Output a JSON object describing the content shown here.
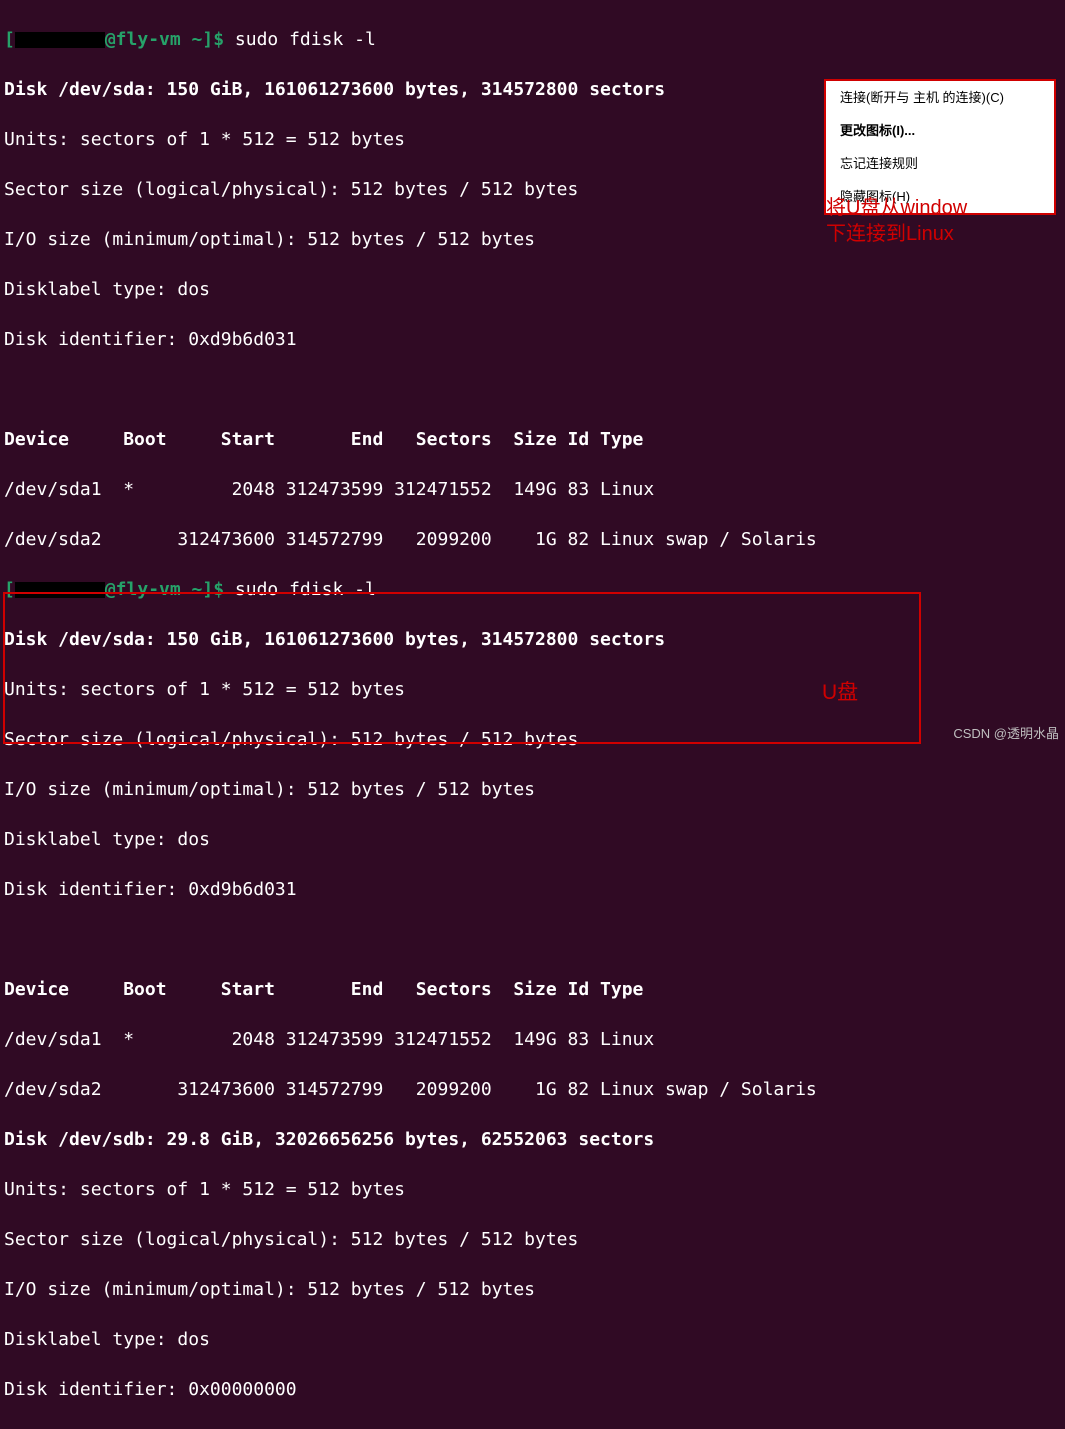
{
  "prompt1": {
    "user": "@fly-vm",
    "path": " ~",
    "cmd": "sudo fdisk -l"
  },
  "out1": {
    "diskline": "Disk /dev/sda: 150 GiB, 161061273600 bytes, 314572800 sectors",
    "units": "Units: sectors of 1 * 512 = 512 bytes",
    "sector": "Sector size (logical/physical): 512 bytes / 512 bytes",
    "io": "I/O size (minimum/optimal): 512 bytes / 512 bytes",
    "label": "Disklabel type: dos",
    "ident": "Disk identifier: 0xd9b6d031"
  },
  "table1": {
    "header": "Device     Boot     Start       End   Sectors  Size Id Type",
    "row1": "/dev/sda1  *         2048 312473599 312471552  149G 83 Linux",
    "row2": "/dev/sda2       312473600 314572799   2099200    1G 82 Linux swap / Solaris"
  },
  "prompt2": {
    "user": "@fly-vm",
    "path": " ~",
    "cmd": "sudo fdisk -l"
  },
  "out2": {
    "diskline": "Disk /dev/sda: 150 GiB, 161061273600 bytes, 314572800 sectors",
    "units": "Units: sectors of 1 * 512 = 512 bytes",
    "sector": "Sector size (logical/physical): 512 bytes / 512 bytes",
    "io": "I/O size (minimum/optimal): 512 bytes / 512 bytes",
    "label": "Disklabel type: dos",
    "ident": "Disk identifier: 0xd9b6d031"
  },
  "table2": {
    "header": "Device     Boot     Start       End   Sectors  Size Id Type",
    "row1": "/dev/sda1  *         2048 312473599 312471552  149G 83 Linux",
    "row2": "/dev/sda2       312473600 314572799   2099200    1G 82 Linux swap / Solaris"
  },
  "out3": {
    "diskline": "Disk /dev/sdb: 29.8 GiB, 32026656256 bytes, 62552063 sectors",
    "units": "Units: sectors of 1 * 512 = 512 bytes",
    "sector": "Sector size (logical/physical): 512 bytes / 512 bytes",
    "io": "I/O size (minimum/optimal): 512 bytes / 512 bytes",
    "label": "Disklabel type: dos",
    "ident": "Disk identifier: 0x00000000"
  },
  "menu": {
    "item1": "连接(断开与 主机 的连接)(C)",
    "item2": "更改图标(I)...",
    "item3": "忘记连接规则",
    "item4": "隐藏图标(H)"
  },
  "annotation1_line1": "将U盘从window",
  "annotation1_line2": "下连接到Linux",
  "annotation2": "U盘",
  "watermark": "CSDN @透明水晶",
  "brackets": {
    "open": "[",
    "close": "]$ "
  }
}
